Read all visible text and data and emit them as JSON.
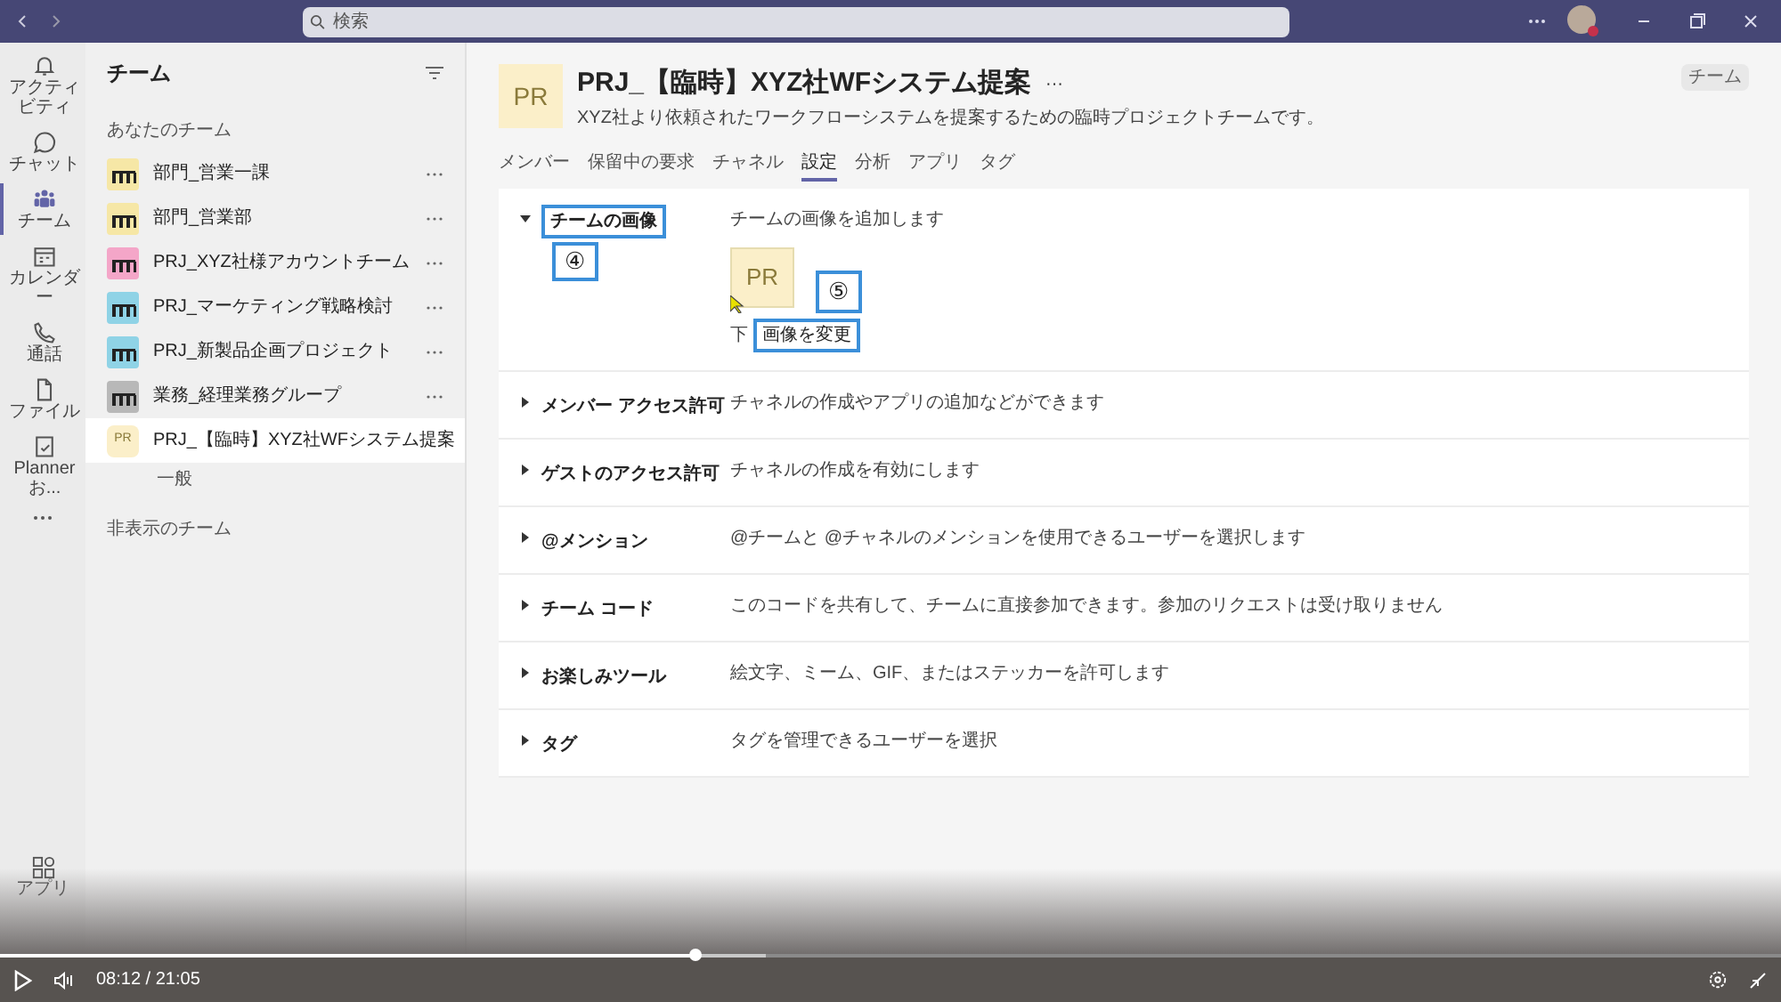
{
  "title_bar": {
    "search_placeholder": "検索"
  },
  "rail": [
    {
      "label": "アクティビティ",
      "kind": "bell",
      "selected": false
    },
    {
      "label": "チャット",
      "kind": "chat",
      "selected": false
    },
    {
      "label": "チーム",
      "kind": "teams",
      "selected": true
    },
    {
      "label": "カレンダー",
      "kind": "calendar",
      "selected": false
    },
    {
      "label": "通話",
      "kind": "phone",
      "selected": false
    },
    {
      "label": "ファイル",
      "kind": "file",
      "selected": false
    },
    {
      "label": "Planner お...",
      "kind": "planner",
      "selected": false
    }
  ],
  "rail_bottom": {
    "label": "アプリ"
  },
  "sidebar": {
    "title": "チーム",
    "section": "あなたのチーム",
    "teams": [
      {
        "name": "部門_営業一課",
        "kind": "pictogram",
        "color": "#f6e7a6",
        "selected": false
      },
      {
        "name": "部門_営業部",
        "kind": "pictogram",
        "color": "#f6e7a6",
        "selected": false
      },
      {
        "name": "PRJ_XYZ社様アカウントチーム",
        "kind": "pictogram",
        "color": "#f4a6c8",
        "selected": false
      },
      {
        "name": "PRJ_マーケティング戦略検討",
        "kind": "pictogram",
        "color": "#8fd3e6",
        "selected": false
      },
      {
        "name": "PRJ_新製品企画プロジェクト",
        "kind": "pictogram",
        "color": "#8fd3e6",
        "selected": false
      },
      {
        "name": "業務_経理業務グループ",
        "kind": "pictogram",
        "color": "#b8b8b8",
        "selected": false
      },
      {
        "name": "PRJ_【臨時】XYZ社WFシステム提案",
        "kind": "initials",
        "initials": "PR",
        "color": "#fbefc9",
        "selected": true,
        "children": [
          "一般"
        ]
      }
    ],
    "hidden_section": "非表示のチーム"
  },
  "header": {
    "initials": "PR",
    "name": "PRJ_【臨時】XYZ社WFシステム提案",
    "more": "···",
    "description": "XYZ社より依頼されたワークフローシステムを提案するための臨時プロジェクトチームです。",
    "badge": "チーム"
  },
  "tabs": [
    {
      "label": "メンバー",
      "selected": false
    },
    {
      "label": "保留中の要求",
      "selected": false
    },
    {
      "label": "チャネル",
      "selected": false
    },
    {
      "label": "設定",
      "selected": true
    },
    {
      "label": "分析",
      "selected": false
    },
    {
      "label": "アプリ",
      "selected": false
    },
    {
      "label": "タグ",
      "selected": false
    }
  ],
  "settings": [
    {
      "label": "チームの画像",
      "description": "チームの画像を追加します",
      "expanded": true,
      "image_initials": "PR",
      "partial_text": "下",
      "link": "画像を変更"
    },
    {
      "label": "メンバー アクセス許可",
      "description": "チャネルの作成やアプリの追加などができます",
      "expanded": false
    },
    {
      "label": "ゲストのアクセス許可",
      "description": "チャネルの作成を有効にします",
      "expanded": false
    },
    {
      "label": "@メンション",
      "description": "@チームと @チャネルのメンションを使用できるユーザーを選択します",
      "expanded": false
    },
    {
      "label": "チーム コード",
      "description": "このコードを共有して、チームに直接参加できます。参加のリクエストは受け取りません",
      "expanded": false
    },
    {
      "label": "お楽しみツール",
      "description": "絵文字、ミーム、GIF、またはステッカーを許可します",
      "expanded": false
    },
    {
      "label": "タグ",
      "description": "タグを管理できるユーザーを選択",
      "expanded": false
    }
  ],
  "annotations": [
    "④",
    "⑤"
  ],
  "video": {
    "level": 0.39,
    "buffer": {
      "level": 0.43
    },
    "time": "08:12 / 21:05"
  }
}
